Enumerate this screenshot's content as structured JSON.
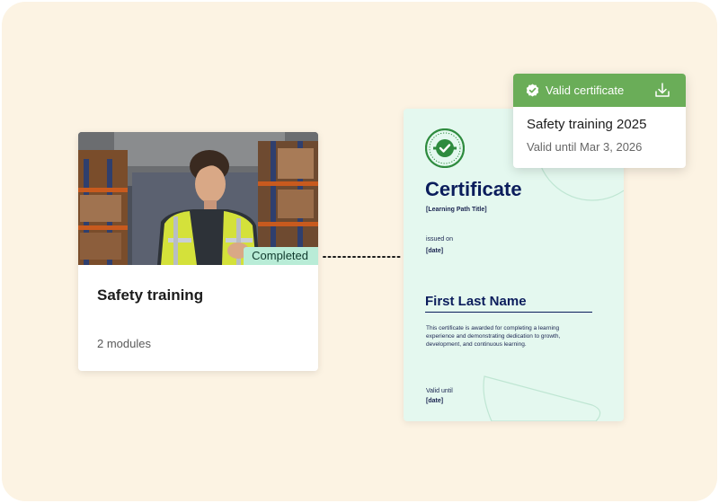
{
  "colors": {
    "background": "#fcf3e3",
    "completed_badge": "#b9ecd7",
    "popup_header": "#6aad58",
    "certificate_sheet": "#e4f8ef",
    "certificate_ink": "#0b1d5c",
    "seal_green": "#2e8b3e"
  },
  "course_card": {
    "image": "warehouse-worker-photo",
    "status_badge": "Completed",
    "title": "Safety training",
    "modules": "2 modules"
  },
  "certificate": {
    "seal_text": "CERTIFIED",
    "heading": "Certificate",
    "path_title": "[Learning Path Title]",
    "issued_label": "issued on",
    "issued_date": "[date]",
    "recipient_name": "First Last Name",
    "body": "This certificate is awarded for completing a learning experience and demonstrating dedication to growth, development, and continuous learning.",
    "valid_label": "Valid until",
    "valid_date": "[date]"
  },
  "popup": {
    "header_label": "Valid certificate",
    "check_icon": "check-badge-icon",
    "download_icon": "download-icon",
    "title": "Safety training 2025",
    "subtitle": "Valid until Mar 3, 2026"
  }
}
